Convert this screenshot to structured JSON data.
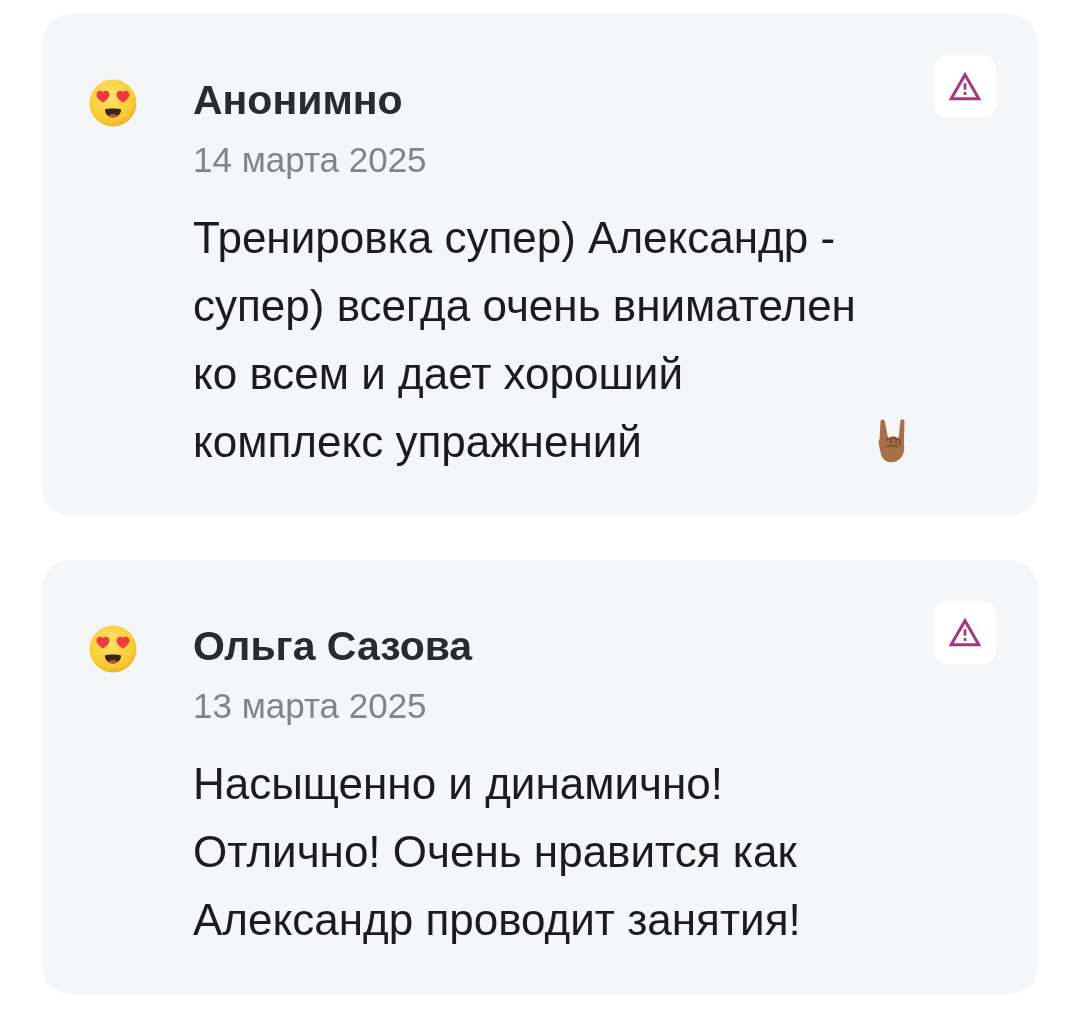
{
  "reviews": [
    {
      "author": "Анонимно",
      "date": "14 марта 2025",
      "text": "Тренировка супер) Александр - супер) всегда очень внимателен ко всем и дает хороший комплекс упражнений",
      "trailing_emoji": {
        "kind": "rock-hand"
      }
    },
    {
      "author": "Ольга Сазова",
      "date": "13 марта 2025",
      "text": "Насыщенно и динамично! Отлично! Очень нравится как Александр проводит занятия!"
    }
  ]
}
